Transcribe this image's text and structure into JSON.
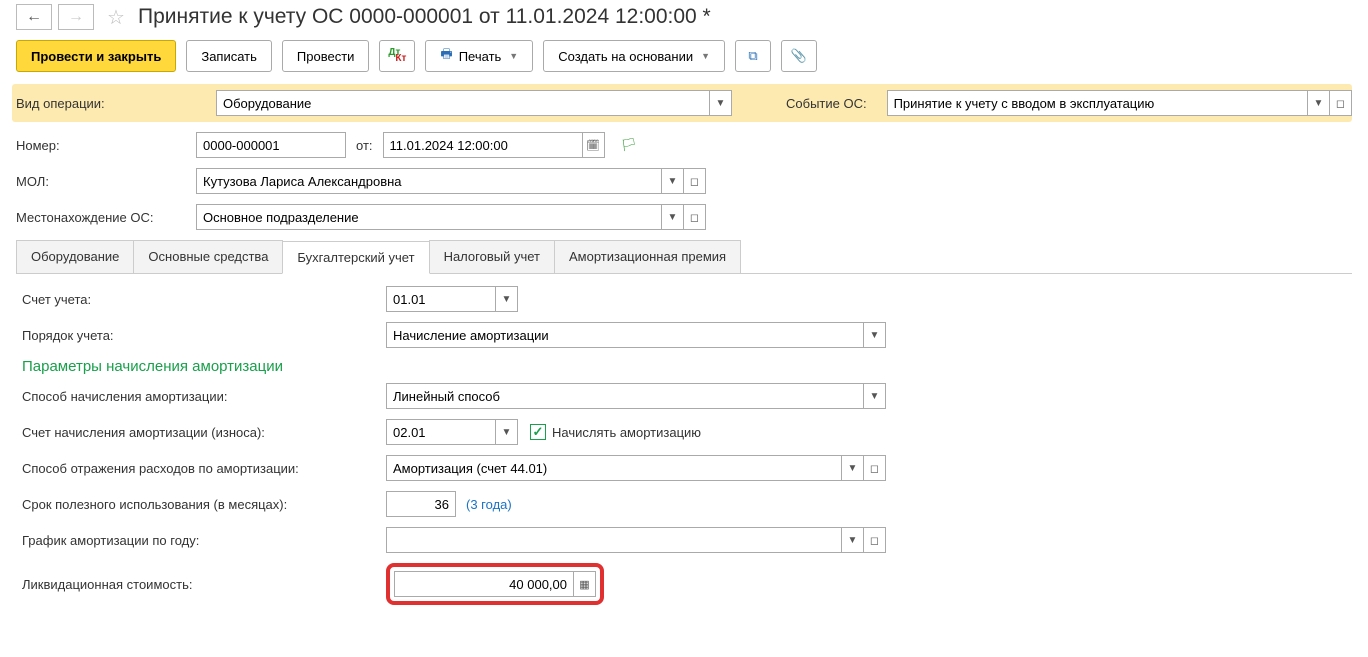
{
  "header": {
    "title": "Принятие к учету ОС 0000-000001 от 11.01.2024 12:00:00 *"
  },
  "toolbar": {
    "post_close": "Провести и закрыть",
    "write": "Записать",
    "post": "Провести",
    "print": "Печать",
    "create_based": "Создать на основании"
  },
  "fields": {
    "op_type_label": "Вид операции:",
    "op_type_value": "Оборудование",
    "event_label": "Событие ОС:",
    "event_value": "Принятие к учету с вводом в эксплуатацию",
    "number_label": "Номер:",
    "number_value": "0000-000001",
    "date_label": "от:",
    "date_value": "11.01.2024 12:00:00",
    "mol_label": "МОЛ:",
    "mol_value": "Кутузова Лариса Александровна",
    "location_label": "Местонахождение ОС:",
    "location_value": "Основное подразделение"
  },
  "tabs": {
    "t0": "Оборудование",
    "t1": "Основные средства",
    "t2": "Бухгалтерский учет",
    "t3": "Налоговый учет",
    "t4": "Амортизационная премия"
  },
  "accounting": {
    "account_label": "Счет учета:",
    "account_value": "01.01",
    "order_label": "Порядок учета:",
    "order_value": "Начисление амортизации",
    "section_title": "Параметры начисления амортизации",
    "method_label": "Способ начисления амортизации:",
    "method_value": "Линейный способ",
    "depr_account_label": "Счет начисления амортизации (износа):",
    "depr_account_value": "02.01",
    "do_depr_label": "Начислять амортизацию",
    "expense_label": "Способ отражения расходов по амортизации:",
    "expense_value": "Амортизация (счет 44.01)",
    "useful_life_label": "Срок полезного использования (в месяцах):",
    "useful_life_value": "36",
    "useful_life_hint": "(3 года)",
    "schedule_label": "График амортизации по году:",
    "schedule_value": "",
    "salvage_label": "Ликвидационная стоимость:",
    "salvage_value": "40 000,00"
  }
}
